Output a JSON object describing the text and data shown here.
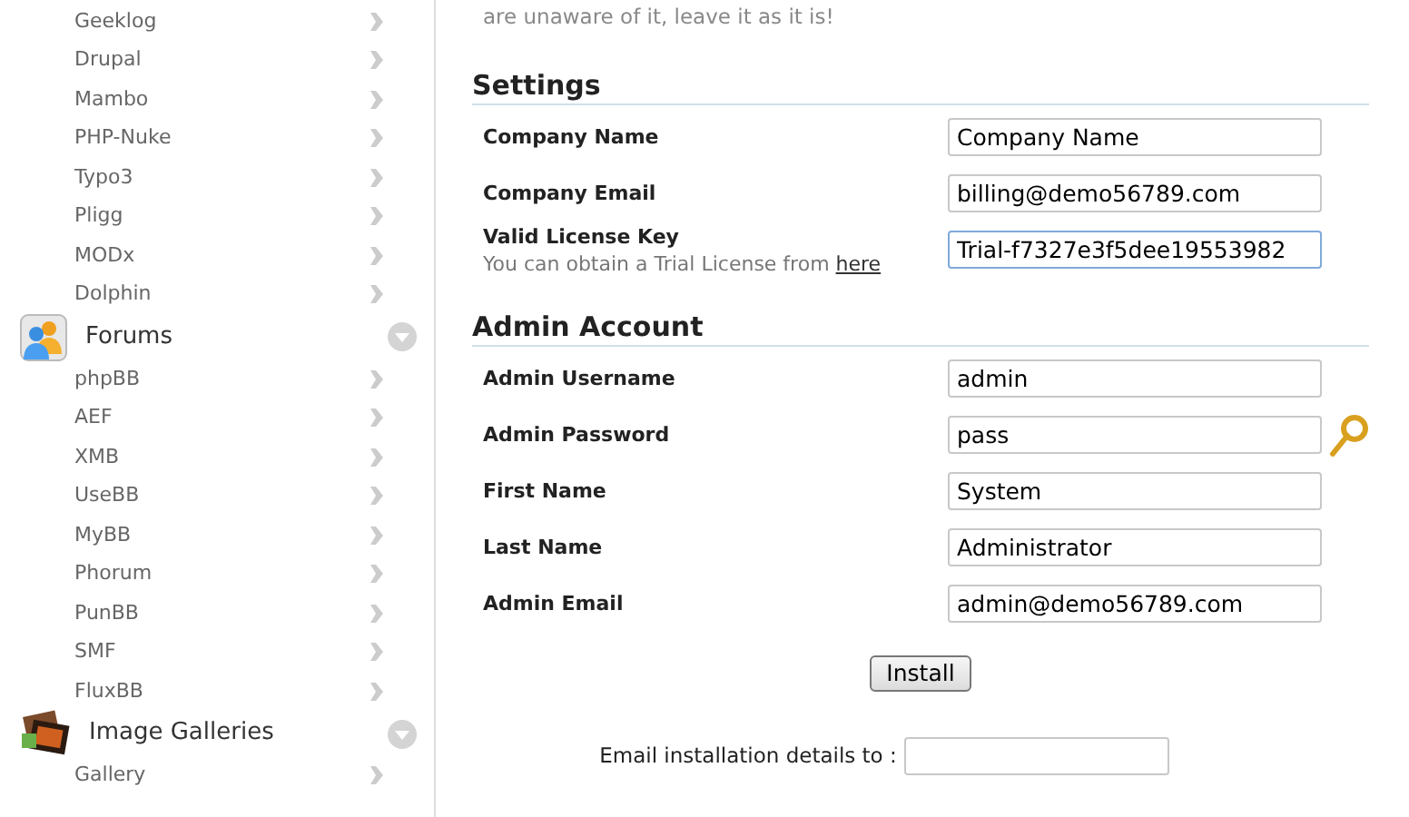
{
  "sidebar": {
    "sections": [
      {
        "items": [
          "Geeklog",
          "Drupal",
          "Mambo",
          "PHP-Nuke",
          "Typo3",
          "Pligg",
          "MODx",
          "Dolphin"
        ]
      },
      {
        "title": "Forums",
        "kind": "people",
        "expanded": true,
        "items": [
          "phpBB",
          "AEF",
          "XMB",
          "UseBB",
          "MyBB",
          "Phorum",
          "PunBB",
          "SMF",
          "FluxBB"
        ]
      },
      {
        "title": "Image Galleries",
        "kind": "photos",
        "expanded": true,
        "items": [
          "Gallery"
        ]
      }
    ]
  },
  "intro": "are unaware of it, leave it as it is!",
  "sections": [
    {
      "title": "Settings",
      "fields": [
        {
          "label": "Company Name",
          "kind": "text",
          "value": "Company Name",
          "focused": false
        },
        {
          "label": "Company Email",
          "kind": "text",
          "value": "billing@demo56789.com",
          "focused": false
        },
        {
          "label": "Valid License Key",
          "hint": "You can obtain a Trial License from",
          "link": "here",
          "kind": "text",
          "value": "Trial-f7327e3f5dee19553982",
          "focused": true
        }
      ]
    },
    {
      "title": "Admin Account",
      "fields": [
        {
          "label": "Admin Username",
          "kind": "text",
          "value": "admin",
          "focused": false
        },
        {
          "label": "Admin Password",
          "kind": "password",
          "value": "pass",
          "focused": false
        },
        {
          "label": "First Name",
          "kind": "text",
          "value": "System",
          "focused": false
        },
        {
          "label": "Last Name",
          "kind": "text",
          "value": "Administrator",
          "focused": false
        },
        {
          "label": "Admin Email",
          "kind": "text",
          "value": "admin@demo56789.com",
          "focused": false
        }
      ]
    }
  ],
  "install_button": "Install",
  "email_details": {
    "label": "Email installation details to :"
  }
}
